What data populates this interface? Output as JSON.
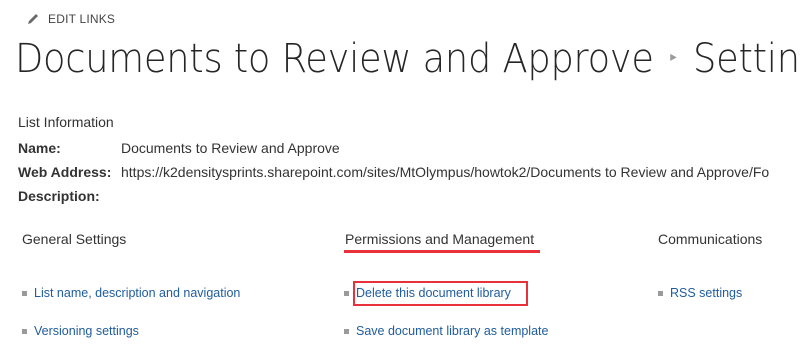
{
  "header": {
    "edit_links_label": "EDIT LINKS",
    "title_primary": "Documents to Review and Approve",
    "title_secondary": "Settings"
  },
  "list_information": {
    "heading": "List Information",
    "name_label": "Name:",
    "name_value": "Documents to Review and Approve",
    "web_address_label": "Web Address:",
    "web_address_value": "https://k2densitysprints.sharepoint.com/sites/MtOlympus/howtok2/Documents to Review and Approve/Fo",
    "description_label": "Description:"
  },
  "sections": {
    "general": {
      "title": "General Settings",
      "links": [
        "List name, description and navigation",
        "Versioning settings"
      ]
    },
    "permissions": {
      "title": "Permissions and Management",
      "links": [
        "Delete this document library",
        "Save document library as template"
      ]
    },
    "communications": {
      "title": "Communications",
      "links": [
        "RSS settings"
      ]
    }
  },
  "colors": {
    "link": "#1f5c9d",
    "highlight": "#e8313b",
    "text": "#333333"
  }
}
